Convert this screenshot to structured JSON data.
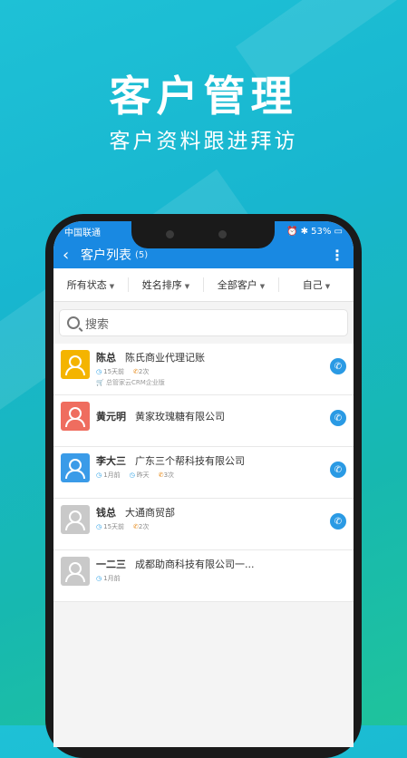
{
  "hero": {
    "title": "客户管理",
    "subtitle": "客户资料跟进拜访"
  },
  "status": {
    "carrier": "中国联通",
    "battery": "53%"
  },
  "nav": {
    "title": "客户列表",
    "count": "(5)"
  },
  "filters": [
    "所有状态",
    "姓名排序",
    "全部客户",
    "自己"
  ],
  "search": {
    "placeholder": "搜索"
  },
  "customers": [
    {
      "name": "陈总",
      "company": "陈氏商业代理记账",
      "meta1": "15天前",
      "meta2": "2次",
      "extra": "总管家云CRM企业版",
      "color": "#f4b400"
    },
    {
      "name": "黄元明",
      "company": "黄家玫瑰糖有限公司",
      "color": "#ef6d5f"
    },
    {
      "name": "李大三",
      "company": "广东三个帮科技有限公司",
      "meta1": "1月前",
      "meta2": "昨天",
      "meta3": "3次",
      "color": "#3a9be8"
    },
    {
      "name": "钱总",
      "company": "大通商贸部",
      "meta1": "15天前",
      "meta2": "2次",
      "color": "#c9c9c9"
    },
    {
      "name": "一二三",
      "company": "成都助商科技有限公司一...",
      "meta1": "1月前",
      "color": "#c9c9c9"
    }
  ]
}
